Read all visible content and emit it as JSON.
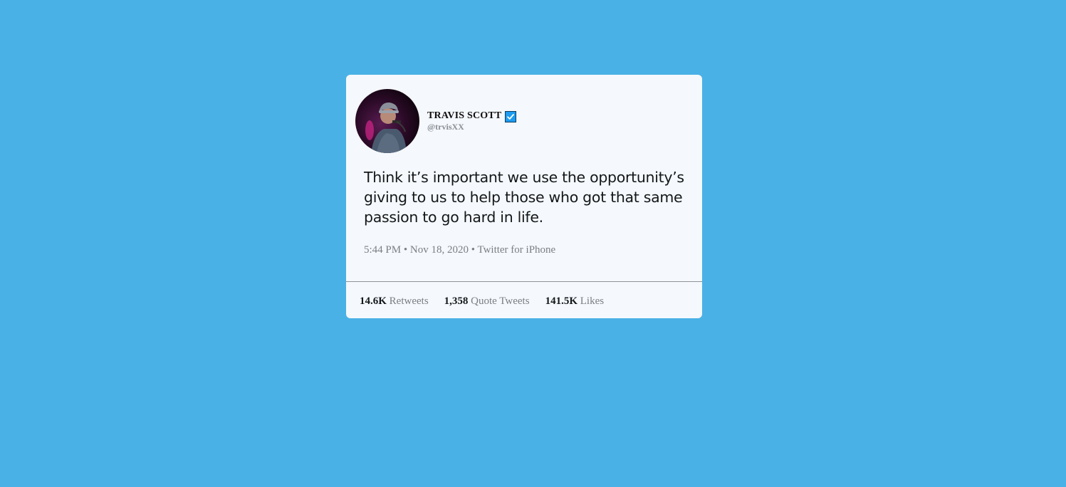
{
  "tweet": {
    "user": {
      "display_name": "TRAVIS SCOTT",
      "handle": "@trvisXX",
      "verified_icon": "verified-badge-icon"
    },
    "text": "Think it’s important we use the opportunity’s giving to us to help those who got that same passion to go hard in life.",
    "meta": {
      "time": "5:44 PM",
      "separator": " • ",
      "date": "Nov 18, 2020",
      "source": "Twitter for iPhone"
    },
    "stats": [
      {
        "count": "14.6K",
        "label": "Retweets"
      },
      {
        "count": "1,358",
        "label": "Quote Tweets"
      },
      {
        "count": "141.5K",
        "label": "Likes"
      }
    ]
  },
  "colors": {
    "page_background": "#4ab1e6",
    "card_background": "#f5f8fc",
    "verified_blue": "#1d9bf0"
  }
}
